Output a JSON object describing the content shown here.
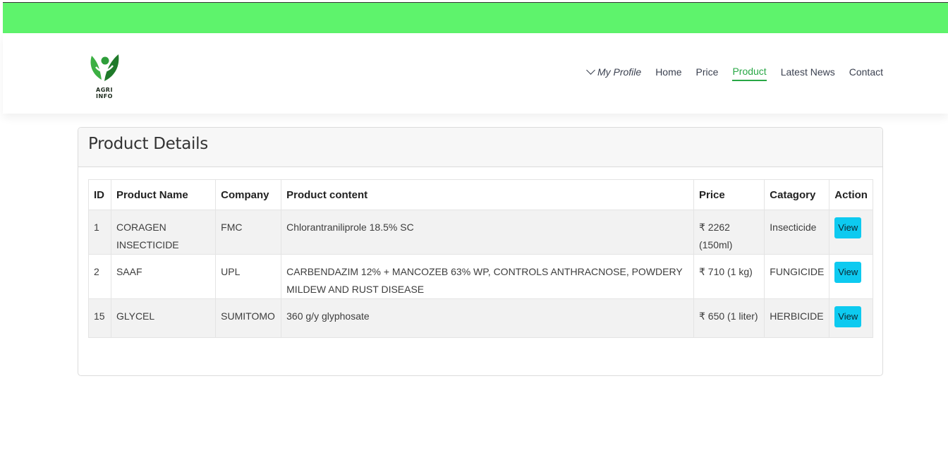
{
  "brand": {
    "logo_text": "AGRI INFO",
    "colors": {
      "leaf_green": "#3cb043",
      "leaf_dark": "#1f7a2a",
      "accent": "#28a745",
      "top_strip": "#5ef36c",
      "button": "#0dcaf0"
    }
  },
  "nav": {
    "profile": "My Profile",
    "items": [
      {
        "label": "Home",
        "active": false
      },
      {
        "label": "Price",
        "active": false
      },
      {
        "label": "Product",
        "active": true
      },
      {
        "label": "Latest News",
        "active": false
      },
      {
        "label": "Contact",
        "active": false
      }
    ]
  },
  "card": {
    "title": "Product Details"
  },
  "table": {
    "headers": {
      "id": "ID",
      "name": "Product Name",
      "company": "Company",
      "content": "Product content",
      "price": "Price",
      "category": "Catagory",
      "action": "Action"
    },
    "rows": [
      {
        "id": "1",
        "name": "CORAGEN INSECTICIDE",
        "company": "FMC",
        "content": "Chlorantraniliprole 18.5% SC",
        "price": "₹ 2262 (150ml)",
        "category": "Insecticide",
        "action": "View"
      },
      {
        "id": "2",
        "name": "SAAF",
        "company": "UPL",
        "content": "CARBENDAZIM 12% + MANCOZEB 63% WP, CONTROLS ANTHRACNOSE, POWDERY MILDEW AND RUST DISEASE",
        "price": "₹ 710 (1 kg)",
        "category": "FUNGICIDE",
        "action": "View"
      },
      {
        "id": "15",
        "name": "GLYCEL",
        "company": "SUMITOMO",
        "content": "360 g/y glyphosate",
        "price": "₹ 650 (1 liter)",
        "category": "HERBICIDE",
        "action": "View"
      }
    ]
  }
}
